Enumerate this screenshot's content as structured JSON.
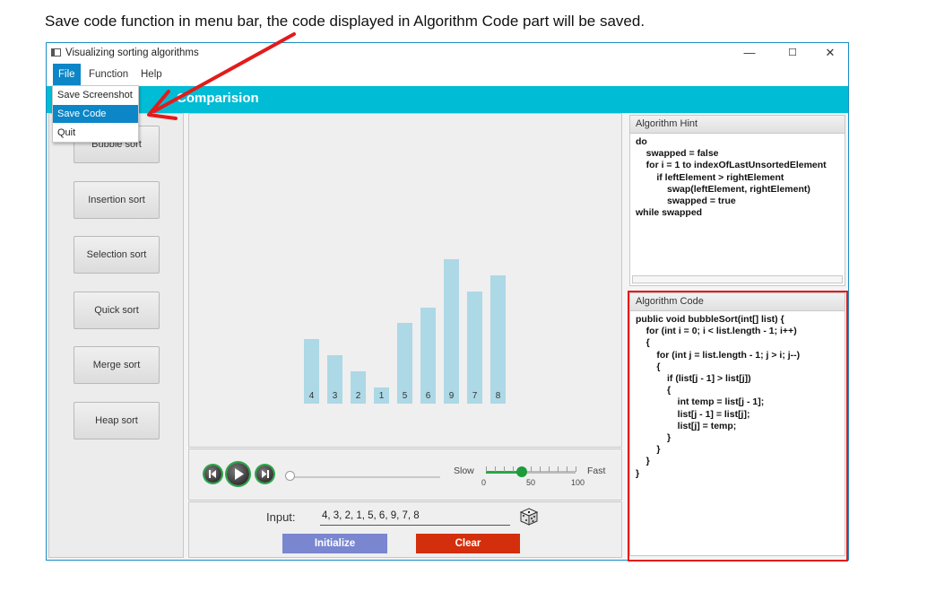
{
  "caption": "Save code function in menu bar, the code displayed in Algorithm Code part will be saved.",
  "window": {
    "title": "Visualizing sorting algorithms",
    "minimize_glyph": "—",
    "maximize_glyph": "☐",
    "close_glyph": "✕"
  },
  "menubar": {
    "items": [
      "File",
      "Function",
      "Help"
    ],
    "active": "File"
  },
  "file_menu": {
    "items": [
      "Save Screenshot",
      "Save Code",
      "Quit"
    ],
    "highlighted": "Save Code"
  },
  "banner_title": "Comparision",
  "sort_buttons": [
    "Bubble sort",
    "Insertion sort",
    "Selection sort",
    "Quick sort",
    "Merge sort",
    "Heap sort"
  ],
  "bars": [
    4,
    3,
    2,
    1,
    5,
    6,
    9,
    7,
    8
  ],
  "bar_color": "#add8e6",
  "player": {
    "buttons": [
      "skip-back-icon",
      "play-icon",
      "skip-forward-icon"
    ],
    "progress": 0
  },
  "speed": {
    "slow_label": "Slow",
    "fast_label": "Fast",
    "ticks": [
      "0",
      "50",
      "100"
    ],
    "min": 0,
    "max": 100,
    "value": 40
  },
  "input": {
    "label": "Input:",
    "value": "4, 3, 2, 1, 5, 6, 9, 7, 8"
  },
  "actions": {
    "initialize": "Initialize",
    "clear": "Clear"
  },
  "hint": {
    "header": "Algorithm Hint",
    "code": "do\n    swapped = false\n    for i = 1 to indexOfLastUnsortedElement\n        if leftElement > rightElement\n            swap(leftElement, rightElement)\n            swapped = true\nwhile swapped"
  },
  "code": {
    "header": "Algorithm Code",
    "code": "public void bubbleSort(int[] list) {\n    for (int i = 0; i < list.length - 1; i++)\n    {\n        for (int j = list.length - 1; j > i; j--)\n        {\n            if (list[j - 1] > list[j])\n            {\n                int temp = list[j - 1];\n                list[j - 1] = list[j];\n                list[j] = temp;\n            }\n        }\n    }\n}"
  },
  "colors": {
    "banner": "#00bcd4",
    "menu_highlight": "#0c86c6",
    "initialize": "#7a86cf",
    "clear": "#d32f0c",
    "annotation": "#e31b1b",
    "speed_accent": "#28a745"
  }
}
